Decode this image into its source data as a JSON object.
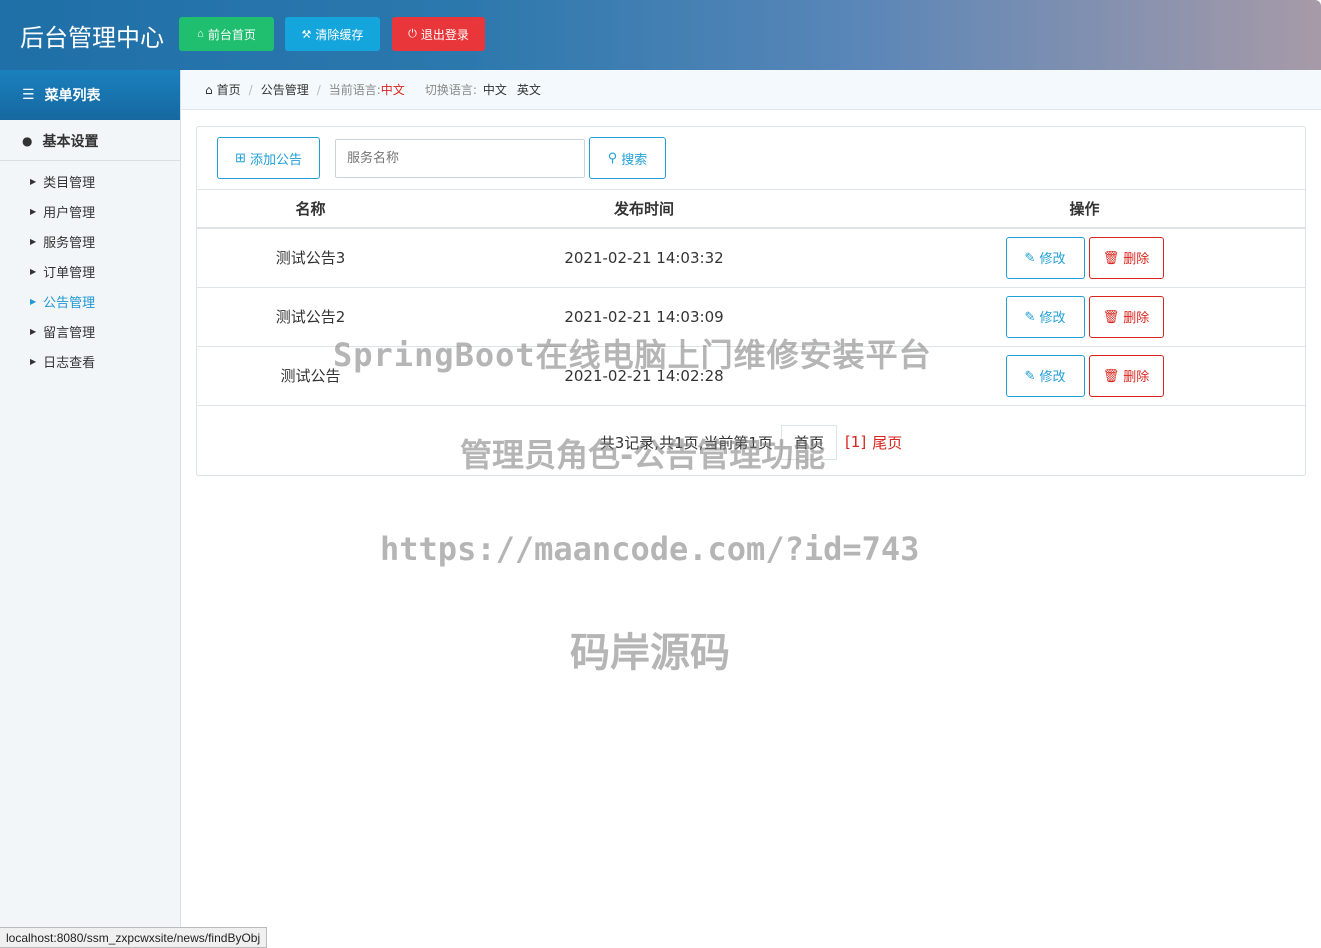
{
  "header": {
    "brand": "后台管理中心",
    "buttons": [
      {
        "label": "前台首页",
        "icon": "home-icon",
        "color": "#1fbf6f"
      },
      {
        "label": "清除缓存",
        "icon": "wrench-icon",
        "color": "#14a5dd"
      },
      {
        "label": "退出登录",
        "icon": "power-icon",
        "color": "#e8363a"
      }
    ]
  },
  "sidebar": {
    "menu_title": "菜单列表",
    "section_title": "基本设置",
    "items": [
      {
        "label": "类目管理",
        "active": false
      },
      {
        "label": "用户管理",
        "active": false
      },
      {
        "label": "服务管理",
        "active": false
      },
      {
        "label": "订单管理",
        "active": false
      },
      {
        "label": "公告管理",
        "active": true
      },
      {
        "label": "留言管理",
        "active": false
      },
      {
        "label": "日志查看",
        "active": false
      }
    ]
  },
  "breadcrumb": {
    "home": "首页",
    "current": "公告管理",
    "lang_label": "当前语言:",
    "lang_value": "中文",
    "switch_label": "切换语言:",
    "switch_zh": "中文",
    "switch_en": "英文"
  },
  "toolbar": {
    "add_label": "添加公告",
    "search_placeholder": "服务名称",
    "search_label": "搜索"
  },
  "table": {
    "headers": [
      "名称",
      "发布时间",
      "操作"
    ],
    "rows": [
      {
        "name": "测试公告3",
        "time": "2021-02-21 14:03:32"
      },
      {
        "name": "测试公告2",
        "time": "2021-02-21 14:03:09"
      },
      {
        "name": "测试公告",
        "time": "2021-02-21 14:02:28"
      }
    ],
    "edit_label": "修改",
    "delete_label": "删除"
  },
  "pager": {
    "summary": "共3记录,共1页,当前第1页",
    "first": "首页",
    "current": "[1]",
    "last": "尾页"
  },
  "watermarks": {
    "line1": "SpringBoot在线电脑上门维修安装平台",
    "line2": "管理员角色-公告管理功能",
    "line3": "https://maancode.com/?id=743",
    "line4": "码岸源码"
  },
  "status_url": "localhost:8080/ssm_zxpcwxsite/news/findByObj"
}
